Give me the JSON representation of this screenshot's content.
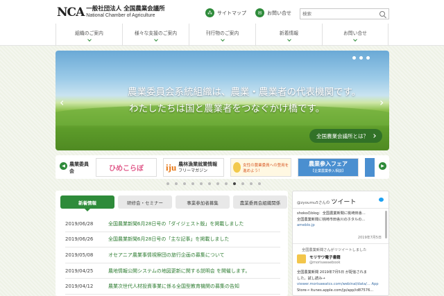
{
  "header": {
    "logo_mark": "NCA",
    "logo_ja": "一般社団法人 全国農業会議所",
    "logo_en": "National Chamber of Agriculture",
    "sitemap_label": "サイトマップ",
    "contact_label": "お問い合せ",
    "search_placeholder": "検索"
  },
  "nav": {
    "items": [
      {
        "label": "組織のご案内"
      },
      {
        "label": "様々な支援のご案内"
      },
      {
        "label": "刊行物のご案内"
      },
      {
        "label": "新着情報"
      },
      {
        "label": "お問い合せ"
      }
    ]
  },
  "hero": {
    "line1": "農業委員会系統組織は、農業・農業者の代表機関です。",
    "line2": "わたしたちは国と農業者をつなぐかけ橋です。",
    "button_label": "全国農業会議所とは？",
    "active_slide": 1,
    "slide_count": 3
  },
  "banners": [
    {
      "label": "農業委員会"
    },
    {
      "label": "ひめこらぼ"
    },
    {
      "mark": "iju",
      "title": "農林漁業就業情報",
      "sub": "フリーマガジン"
    },
    {
      "label": "女性の農業委員への登用を進めよう！"
    },
    {
      "title": "農業参入フェア",
      "sub": "【企業農業参入相談】"
    }
  ],
  "carousel": {
    "dot_count": 12,
    "active_dot": 8
  },
  "news": {
    "tabs": [
      {
        "label": "新着情報",
        "active": true
      },
      {
        "label": "研修会・セミナー",
        "active": false
      },
      {
        "label": "事業参加者募集",
        "active": false
      },
      {
        "label": "農業委員会組織関係",
        "active": false
      }
    ],
    "items": [
      {
        "date": "2019/06/28",
        "title": "全国農業新聞6月28日号の「ダイジェスト版」を掲載しました"
      },
      {
        "date": "2019/06/26",
        "title": "全国農業新聞6月28日号の「主な記事」を掲載しました"
      },
      {
        "date": "2019/05/08",
        "title": "オセアニア農業事情視察団の旅行企画の募集について"
      },
      {
        "date": "2019/04/25",
        "title": "農地情報公開システムの地図更新に関する説明会 を開催します。"
      },
      {
        "date": "2019/04/12",
        "title": "農業次世代人材投資事業に係る全国型教育機関の募集の告知"
      }
    ]
  },
  "tweets": {
    "header_prefix": "@zyoumu5さんの",
    "header_title": "ツイート",
    "tweet1": {
      "line1": "shokoのblog：全国農業新聞に桃崎田舎...",
      "line2": "全国農業新聞に桃崎市田舎川のホタルの...",
      "link": "ameblo.jp",
      "date": "2019年7月5日"
    },
    "retweet_label": "全国農業新聞さんがリツイートしました",
    "tweet2": {
      "name": "モリサワ電子書籍",
      "handle": "@morisawaebook",
      "line1": "全国農業新聞 2019年7月5日 が配信されま",
      "line2": "した。試し読み→",
      "line3": "viewer.morisawatcs.com/webinal/data/... App",
      "line4": "Store→ itunes.apple.com/jp/app/id87576..."
    }
  },
  "colors": {
    "accent": "#2e8b3a",
    "link": "#2e7d32"
  }
}
